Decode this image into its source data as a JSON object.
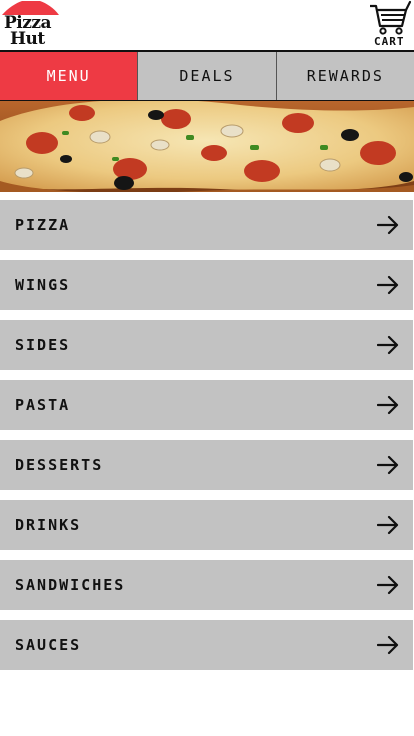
{
  "brand": {
    "logo_line1": "Pizza",
    "logo_line2": "Hut",
    "red": "#ee3a44",
    "logo_icon": "pizza-hut-roof-icon"
  },
  "cart": {
    "label": "CART",
    "icon": "cart-icon"
  },
  "tabs": [
    {
      "label": "MENU",
      "active": true
    },
    {
      "label": "DEALS",
      "active": false
    },
    {
      "label": "REWARDS",
      "active": false
    }
  ],
  "menu_items": [
    {
      "label": "PIZZA",
      "icon": "arrow-right-icon"
    },
    {
      "label": "WINGS",
      "icon": "arrow-right-icon"
    },
    {
      "label": "SIDES",
      "icon": "arrow-right-icon"
    },
    {
      "label": "PASTA",
      "icon": "arrow-right-icon"
    },
    {
      "label": "DESSERTS",
      "icon": "arrow-right-icon"
    },
    {
      "label": "DRINKS",
      "icon": "arrow-right-icon"
    },
    {
      "label": "SANDWICHES",
      "icon": "arrow-right-icon"
    },
    {
      "label": "SAUCES",
      "icon": "arrow-right-icon"
    }
  ],
  "colors": {
    "tab_inactive": "#c2c2c2",
    "menu_item_bg": "#c2c2c2"
  }
}
